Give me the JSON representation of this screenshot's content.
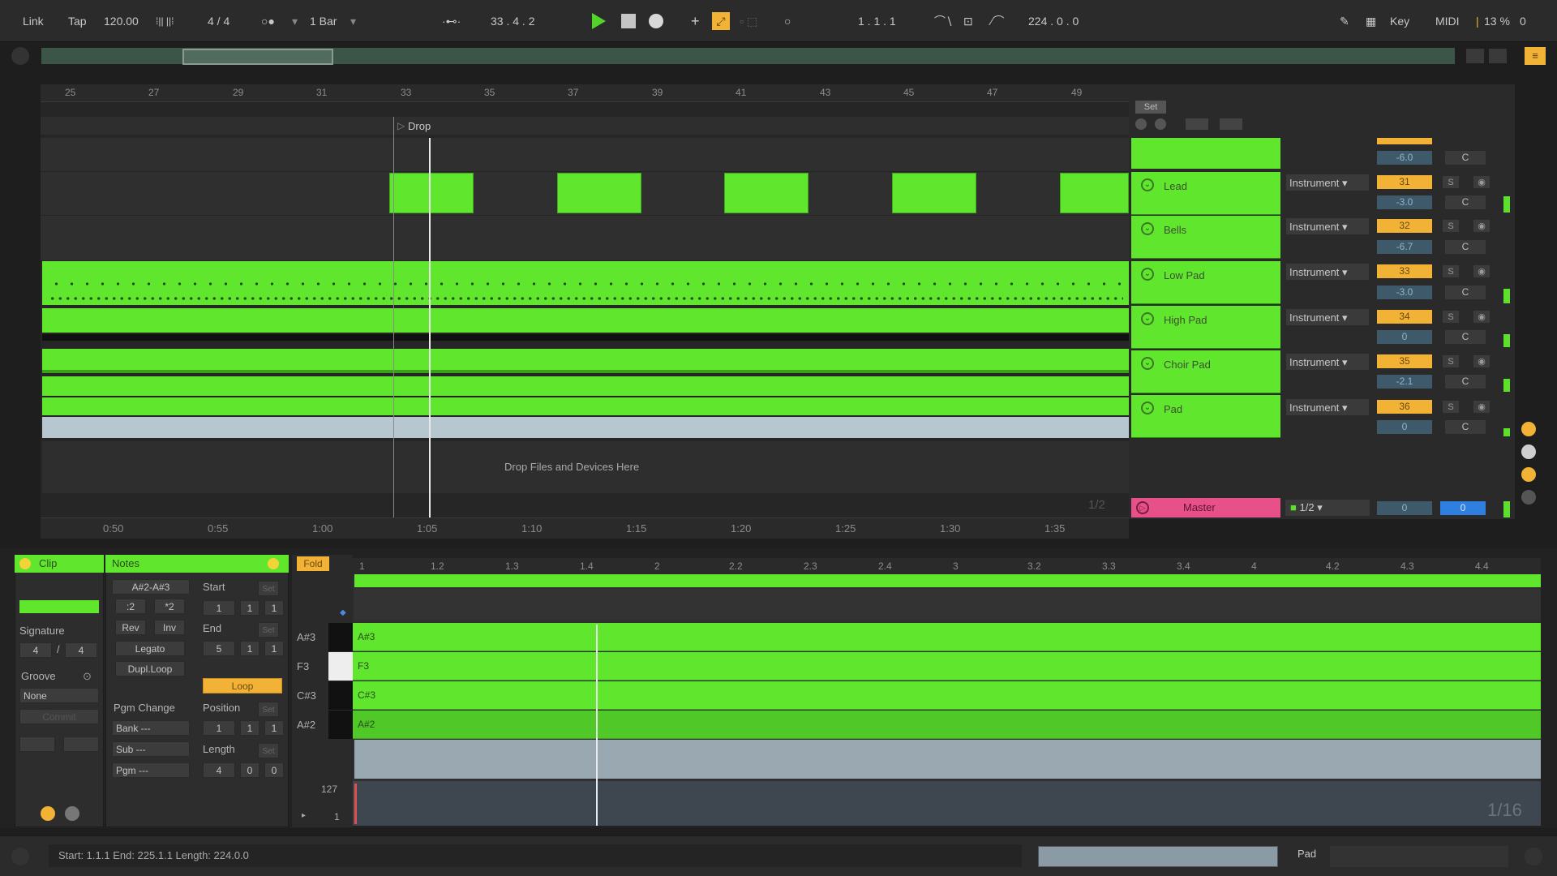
{
  "transport": {
    "link": "Link",
    "tap": "Tap",
    "tempo": "120.00",
    "time_sig": "4 / 4",
    "quantize": "1 Bar",
    "arrangement_position": "33 . 4 . 2",
    "loop_start": "1 . 1 . 1",
    "loop_length": "224 . 0 . 0",
    "key": "Key",
    "midi": "MIDI",
    "cpu": "13 %",
    "cpu_extra": "0"
  },
  "arrangement": {
    "bar_ticks": [
      "25",
      "27",
      "29",
      "31",
      "33",
      "35",
      "37",
      "39",
      "41",
      "43",
      "45",
      "47",
      "49"
    ],
    "locator": "Drop",
    "drop_hint": "Drop Files and Devices Here",
    "time_ticks": [
      "0:50",
      "0:55",
      "1:00",
      "1:05",
      "1:10",
      "1:15",
      "1:20",
      "1:25",
      "1:30",
      "1:35"
    ],
    "zoom_fraction": "1/2",
    "set_label": "Set"
  },
  "tracks": [
    {
      "name": "Lead",
      "input": "Instrument",
      "number": "31",
      "volume": "-3.0",
      "pan": "C"
    },
    {
      "name": "Bells",
      "input": "Instrument",
      "number": "32",
      "volume": "-6.7",
      "pan": "C"
    },
    {
      "name": "Low Pad",
      "input": "Instrument",
      "number": "33",
      "volume": "-3.0",
      "pan": "C"
    },
    {
      "name": "High Pad",
      "input": "Instrument",
      "number": "34",
      "volume": "0",
      "pan": "C"
    },
    {
      "name": "Choir Pad",
      "input": "Instrument",
      "number": "35",
      "volume": "-2.1",
      "pan": "C"
    },
    {
      "name": "Pad",
      "input": "Instrument",
      "number": "36",
      "volume": "0",
      "pan": "C"
    }
  ],
  "top_partial_track": {
    "volume": "-6.0",
    "pan": "C"
  },
  "master": {
    "name": "Master",
    "routing": "1/2",
    "volume": "0",
    "pan": "0"
  },
  "clip_panel": {
    "clip_tab": "Clip",
    "signature_label": "Signature",
    "sig_num": "4",
    "sig_sep": "/",
    "sig_den": "4",
    "groove_label": "Groove",
    "groove_value": "None",
    "commit": "Commit"
  },
  "notes_panel": {
    "title": "Notes",
    "range": "A#2-A#3",
    "div2": ":2",
    "mul2": "*2",
    "rev": "Rev",
    "inv": "Inv",
    "legato": "Legato",
    "dupl_loop": "Dupl.Loop",
    "pgm_change": "Pgm Change",
    "bank": "Bank ---",
    "sub": "Sub ---",
    "pgm": "Pgm ---",
    "start_label": "Start",
    "start_vals": [
      "1",
      "1",
      "1"
    ],
    "end_label": "End",
    "end_vals": [
      "5",
      "1",
      "1"
    ],
    "loop_btn": "Loop",
    "position_label": "Position",
    "position_vals": [
      "1",
      "1",
      "1"
    ],
    "length_label": "Length",
    "length_vals": [
      "4",
      "0",
      "0"
    ],
    "set": "Set"
  },
  "piano_roll": {
    "fold": "Fold",
    "ruler": [
      "1",
      "1.2",
      "1.3",
      "1.4",
      "2",
      "2.2",
      "2.3",
      "2.4",
      "3",
      "3.2",
      "3.3",
      "3.4",
      "4",
      "4.2",
      "4.3",
      "4.4"
    ],
    "keys": [
      "A#3",
      "F3",
      "C#3",
      "A#2"
    ],
    "vel_max": "127",
    "vel_min": "1",
    "grid": "1/16"
  },
  "status_bar": {
    "selection": "Start: 1.1.1  End: 225.1.1  Length: 224.0.0",
    "device": "Pad"
  },
  "colors": {
    "clip_green": "#5fe62d",
    "accent_orange": "#f2b236",
    "master_pink": "#e8508a",
    "play_green": "#54d32a"
  }
}
